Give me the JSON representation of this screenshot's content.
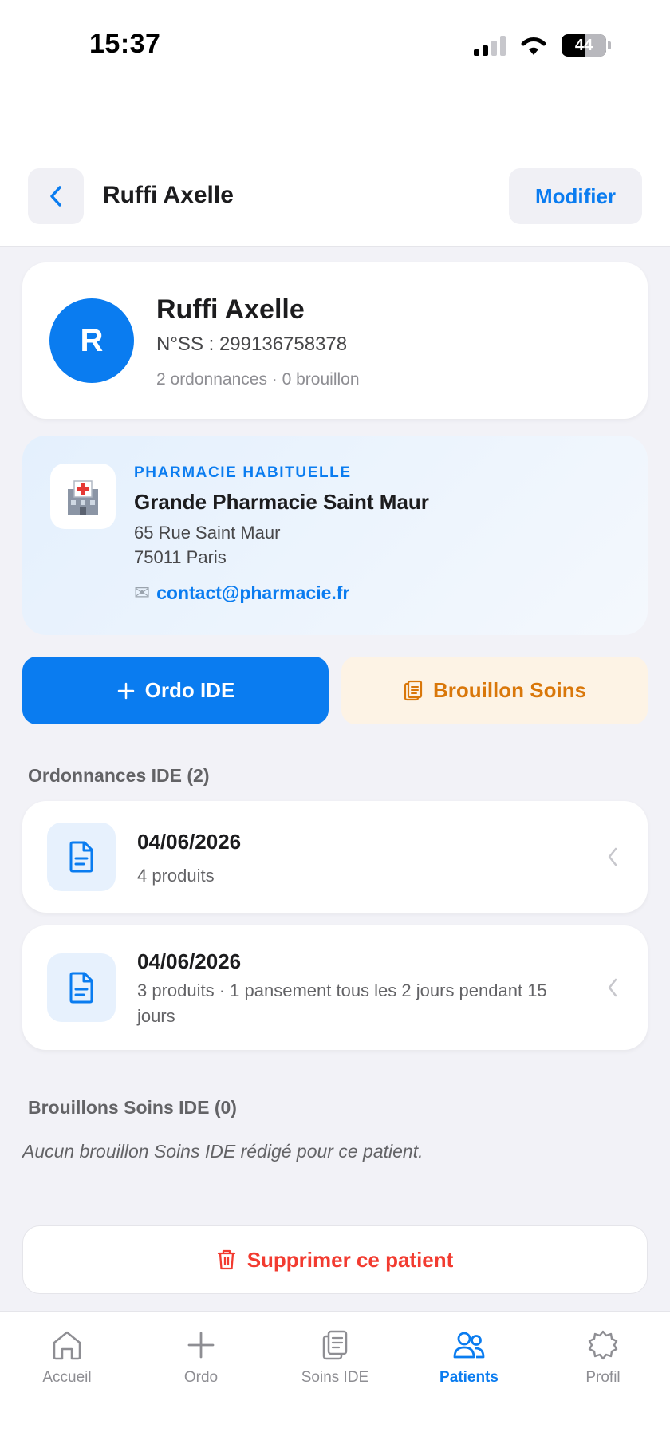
{
  "status_bar": {
    "time": "15:37",
    "battery": "44"
  },
  "header": {
    "title": "Ruffi Axelle",
    "modify_label": "Modifier"
  },
  "patient": {
    "initial": "R",
    "name": "Ruffi Axelle",
    "nss": "N°SS : 299136758378",
    "meta": "2 ordonnances · 0 brouillon"
  },
  "pharmacy": {
    "tag": "PHARMACIE HABITUELLE",
    "name": "Grande Pharmacie Saint Maur",
    "address_line1": "65 Rue Saint Maur",
    "address_line2": "75011 Paris",
    "email": "contact@pharmacie.fr"
  },
  "actions": {
    "ordo_label": "Ordo IDE",
    "brouillon_label": "Brouillon Soins"
  },
  "ordonnances": {
    "title": "Ordonnances IDE (2)",
    "items": [
      {
        "date": "04/06/2026",
        "detail": "4 produits"
      },
      {
        "date": "04/06/2026",
        "detail": "3 produits · 1 pansement tous les 2 jours pendant 15 jours"
      }
    ]
  },
  "brouillons": {
    "title": "Brouillons Soins IDE (0)",
    "empty": "Aucun brouillon Soins IDE rédigé pour ce patient."
  },
  "delete_label": "Supprimer ce patient",
  "tabbar": {
    "items": [
      {
        "label": "Accueil",
        "icon": "home-icon"
      },
      {
        "label": "Ordo",
        "icon": "plus-icon"
      },
      {
        "label": "Soins IDE",
        "icon": "clipboard-icon"
      },
      {
        "label": "Patients",
        "icon": "users-icon",
        "active": true
      },
      {
        "label": "Profil",
        "icon": "gear-icon"
      }
    ]
  },
  "colors": {
    "accent": "#0a7cf0",
    "warning": "#d9770a",
    "danger": "#f23b30",
    "background": "#f2f2f7"
  }
}
